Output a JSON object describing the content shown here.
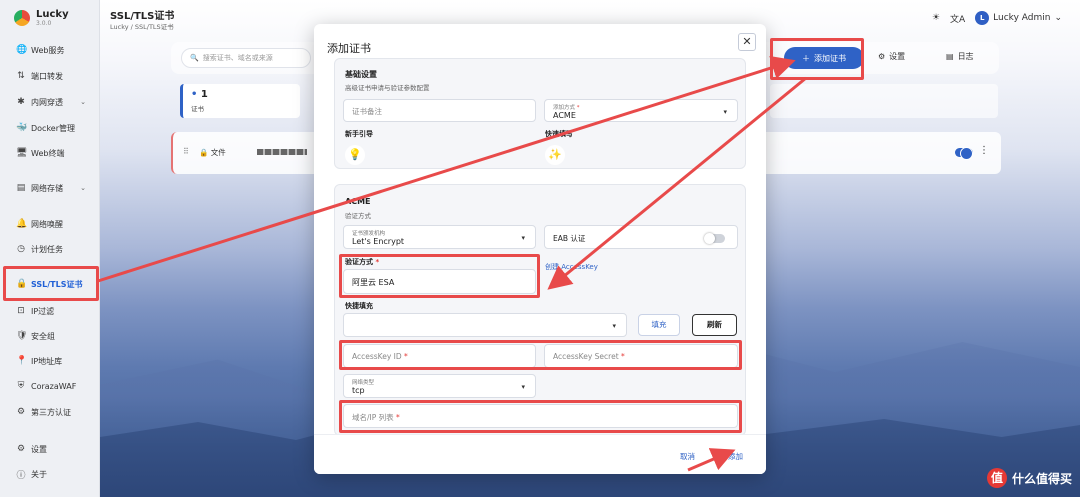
{
  "app": {
    "name": "Lucky",
    "version": "3.0.0"
  },
  "sidebar": {
    "items": [
      {
        "icon": "🌐",
        "label": "Web服务",
        "expand": false
      },
      {
        "icon": "⇅",
        "label": "端口转发",
        "expand": false
      },
      {
        "icon": "✱",
        "label": "内网穿透",
        "expand": true
      },
      {
        "icon": "🐳",
        "label": "Docker管理",
        "expand": false
      },
      {
        "icon": "🖥",
        "label": "Web终端",
        "expand": false
      },
      {
        "icon": "▤",
        "label": "网络存储",
        "expand": true
      },
      {
        "icon": "🔔",
        "label": "网络唤醒",
        "expand": false
      },
      {
        "icon": "◷",
        "label": "计划任务",
        "expand": false
      },
      {
        "icon": "🔒",
        "label": "SSL/TLS证书",
        "expand": false
      },
      {
        "icon": "⊡",
        "label": "IP过滤",
        "expand": false
      },
      {
        "icon": "🛡",
        "label": "安全组",
        "expand": false
      },
      {
        "icon": "📍",
        "label": "IP地址库",
        "expand": false
      },
      {
        "icon": "⛨",
        "label": "CorazaWAF",
        "expand": false
      },
      {
        "icon": "⚙",
        "label": "第三方认证",
        "expand": false
      },
      {
        "icon": "⚙",
        "label": "设置",
        "expand": false
      },
      {
        "icon": "ⓘ",
        "label": "关于",
        "expand": false
      }
    ]
  },
  "header": {
    "title": "SSL/TLS证书",
    "breadcrumb": "Lucky / SSL/TLS证书",
    "user": "Lucky Admin",
    "avatar_letter": "L"
  },
  "toolbar": {
    "search_placeholder": "搜索证书、域名或来源",
    "add_label": "添加证书",
    "settings_label": "设置",
    "log_label": "日志"
  },
  "stats": {
    "count": "1",
    "label": "证书"
  },
  "cert_row": {
    "file_label": "文件"
  },
  "modal": {
    "title": "添加证书",
    "basic": {
      "title": "基础设置",
      "subtitle": "高级证书申请与验证参数配置",
      "remark_placeholder": "证书备注",
      "add_method_label": "添加方式",
      "add_method_value": "ACME",
      "guide_label": "新手引导",
      "quick_label": "快速填写"
    },
    "acme": {
      "title": "ACME",
      "subtitle": "验证方式",
      "ca_label": "证书颁发机构",
      "ca_value": "Let's Encrypt",
      "eab_label": "EAB 认证",
      "verify_label": "验证方式",
      "verify_value": "阿里云 ESA",
      "create_key_link": "创建 AccessKey",
      "quick_fill_label": "快捷填充",
      "fill_btn": "填充",
      "refresh_btn": "刷新",
      "ak_id_placeholder": "AccessKey ID",
      "ak_secret_placeholder": "AccessKey Secret",
      "network_label": "网络类型",
      "network_value": "tcp",
      "domains_placeholder": "域名/IP 列表"
    },
    "cancel": "取消",
    "add": "添加"
  },
  "watermark": {
    "logo_char": "值",
    "text": "什么值得买"
  },
  "colors": {
    "accent": "#2f62c6",
    "highlight": "#e84a4a"
  }
}
